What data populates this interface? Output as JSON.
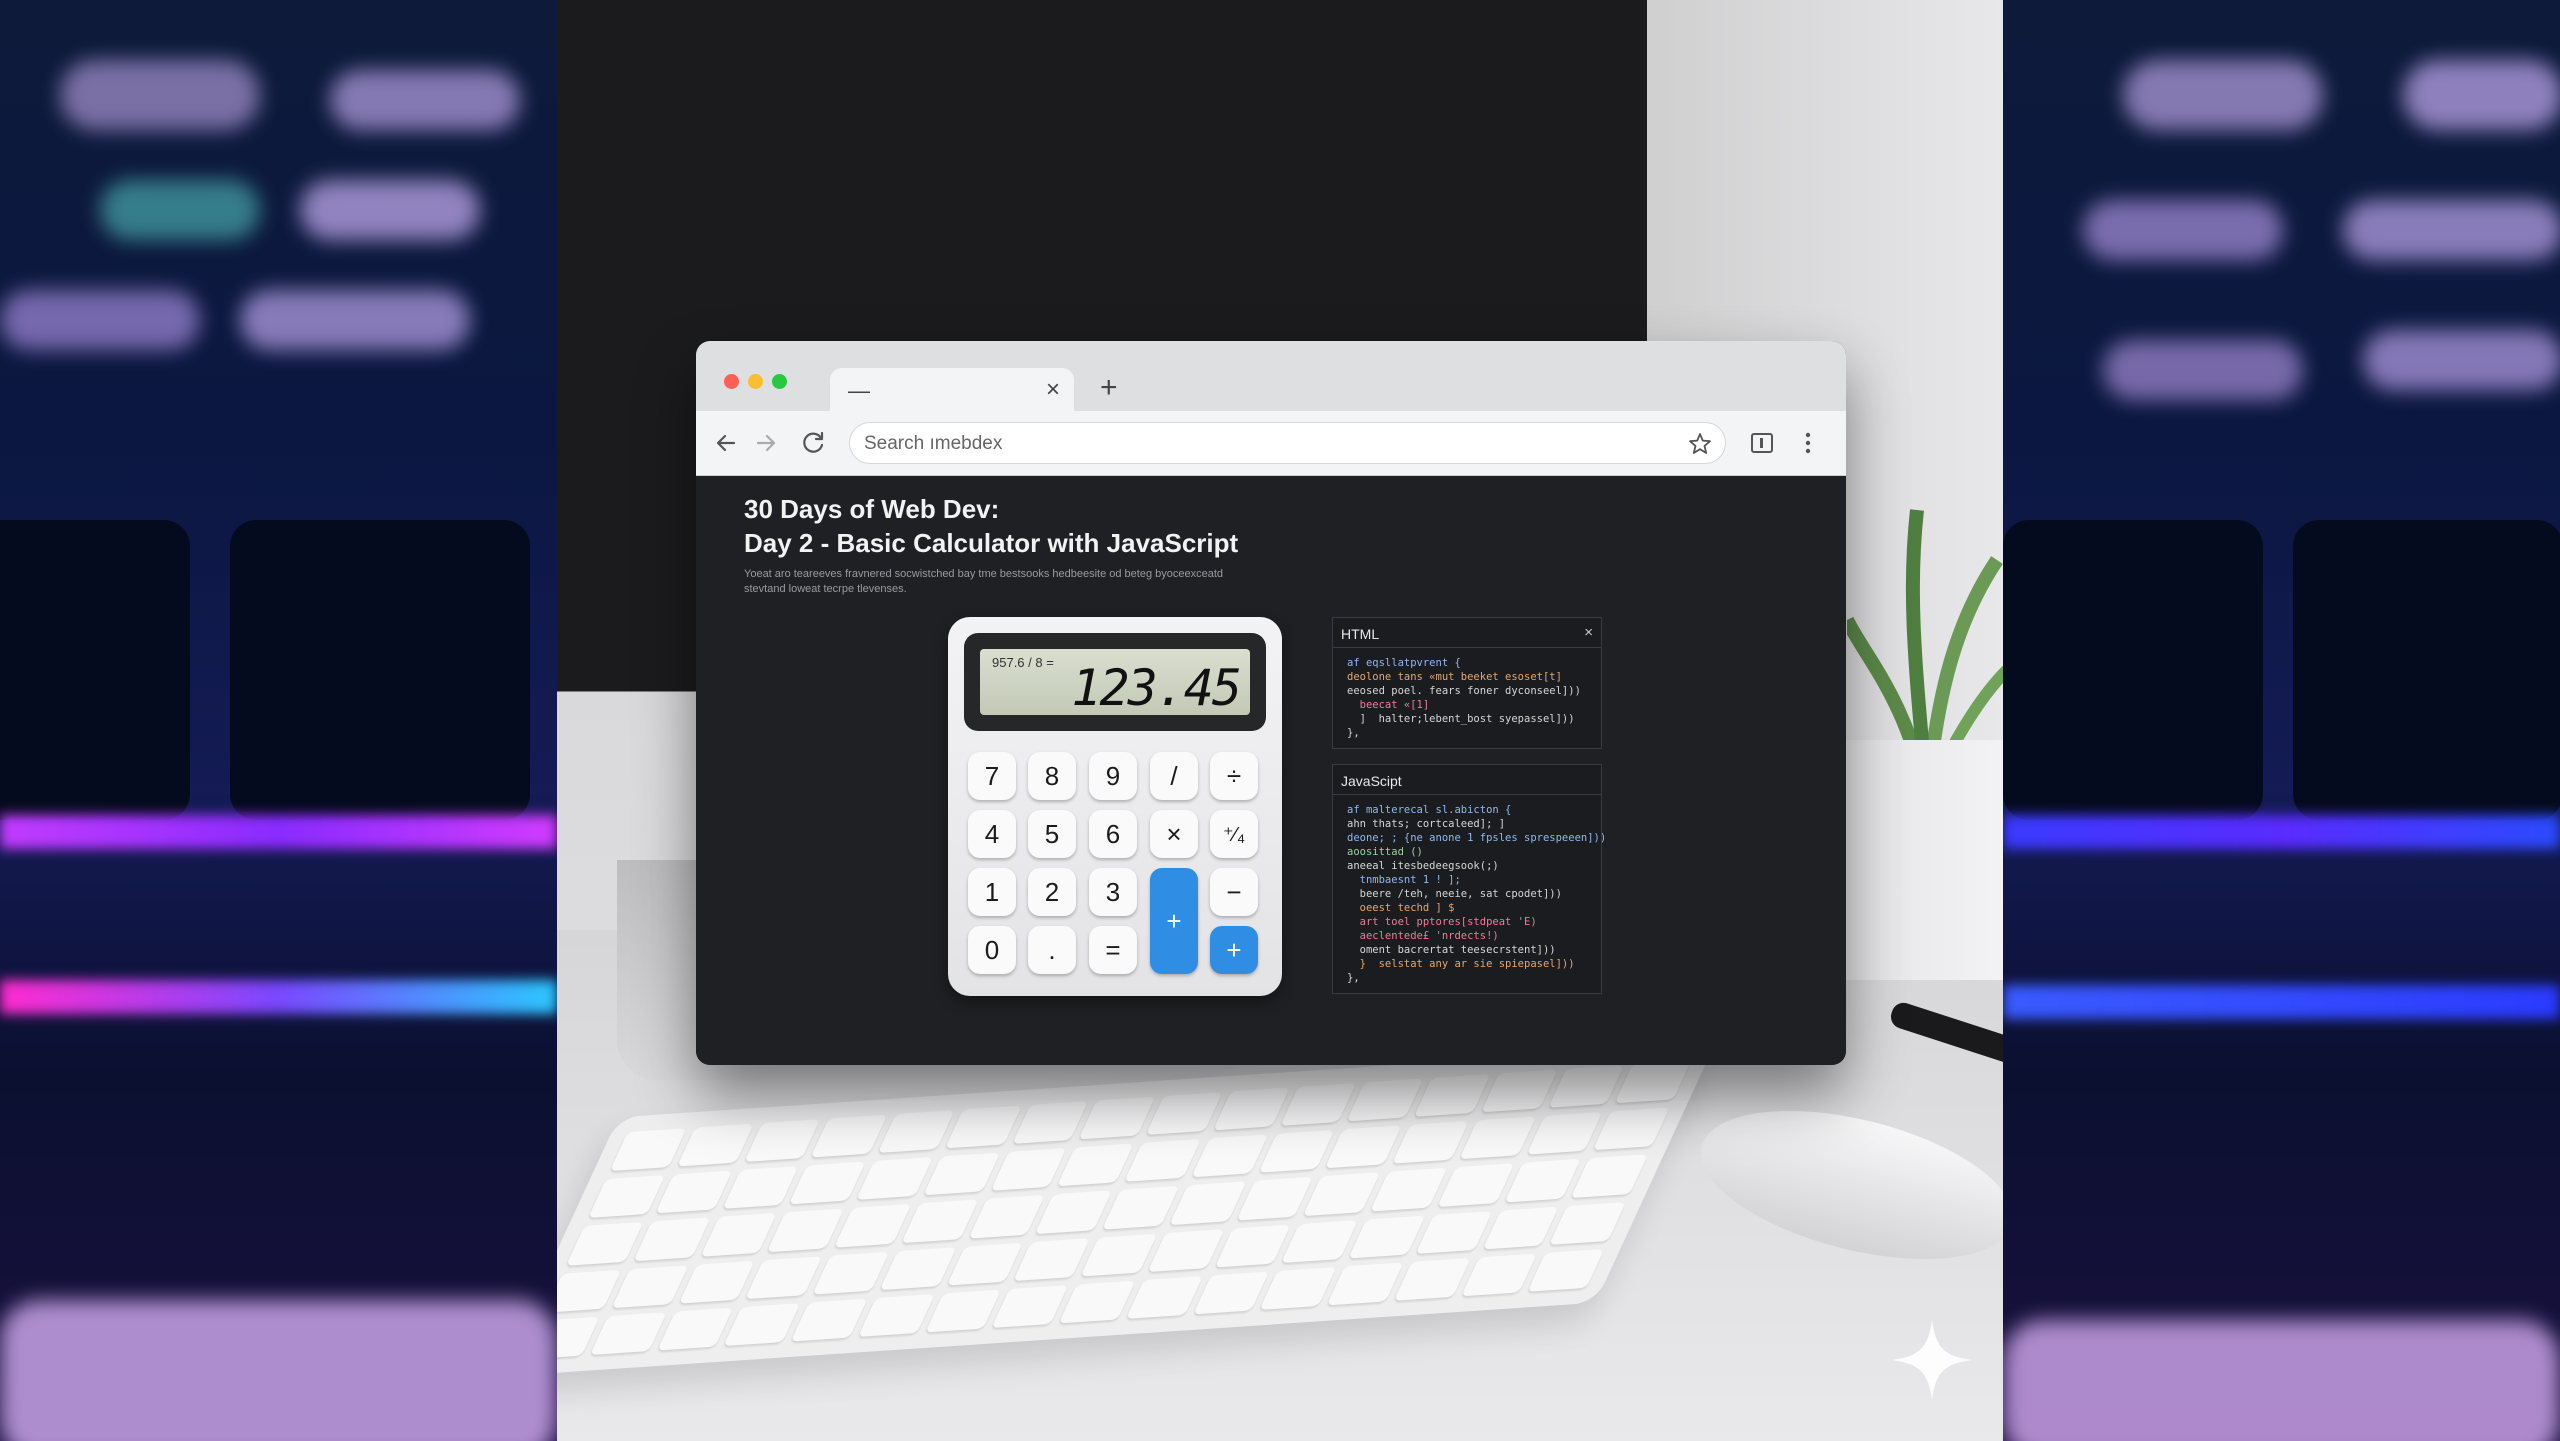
{
  "colors": {
    "accent_blue": "#2f8de4",
    "window_bg": "#1f2023",
    "traffic_red": "#ff5f57",
    "traffic_yellow": "#febc2e",
    "traffic_green": "#28c840"
  },
  "browser": {
    "tab": {
      "title": "—",
      "close": "×"
    },
    "new_tab": "+",
    "address_placeholder": "Search ımebdex",
    "icons": [
      "back-arrow-icon",
      "forward-arrow-icon",
      "reload-icon",
      "star-icon",
      "sidebar-icon",
      "kebab-menu-icon"
    ]
  },
  "page": {
    "title_line1": "30 Days of Web Dev:",
    "title_line2": "Day 2 - Basic Calculator with JavaScript",
    "subtitle_line1": "Yoeat aro teareeves fravnered socwistched bay tme bestsooks hedbeesite od beteg byoceexceatd",
    "subtitle_line2": "stevtand loweat tecrpe tlevenses."
  },
  "calculator": {
    "expression": "957.6 / 8 =",
    "display": "123.45",
    "keys": {
      "k7": "7",
      "k8": "8",
      "k9": "9",
      "slash": "/",
      "divide": "÷",
      "k4": "4",
      "k5": "5",
      "k6": "6",
      "times": "×",
      "percent": "⁺⁄₄",
      "k1": "1",
      "k2": "2",
      "k3": "3",
      "plus_tall": "+",
      "minus": "−",
      "k0": "0",
      "dot": ".",
      "equals": "=",
      "plus": "+"
    }
  },
  "html_panel": {
    "title": "HTML",
    "close": "×",
    "lines": [
      "af eqsllatpvrent {",
      "deolone tans «mut beeket esoset[t]",
      "eeosed poel. fears foner dyconseel]))",
      "  beecat «[1]",
      "  ]  halter;lebent_bost syepassel]))",
      "},"
    ]
  },
  "js_panel": {
    "title": "JavaScipt",
    "lines": [
      "af malterecal sl.abicton {",
      "ahn thats; cortcaleed]; ]",
      "deone; ; {ne anone 1 fpsles sprespeeen]))",
      "aoosittad ()",
      "aneeal itesbedeegsook(;)",
      "  tnmbaesnt 1 ! ];",
      "  beere /teh, neeie, sat cpodet]))",
      "  oeest techd ] $",
      "  art toel pptores[stdpeat 'E)",
      "  aeclentede£ 'nrdects!)",
      "  oment bacrertat teesecrstent]))",
      "  }  selstat any ar sie spiepasel]))",
      "},"
    ]
  }
}
